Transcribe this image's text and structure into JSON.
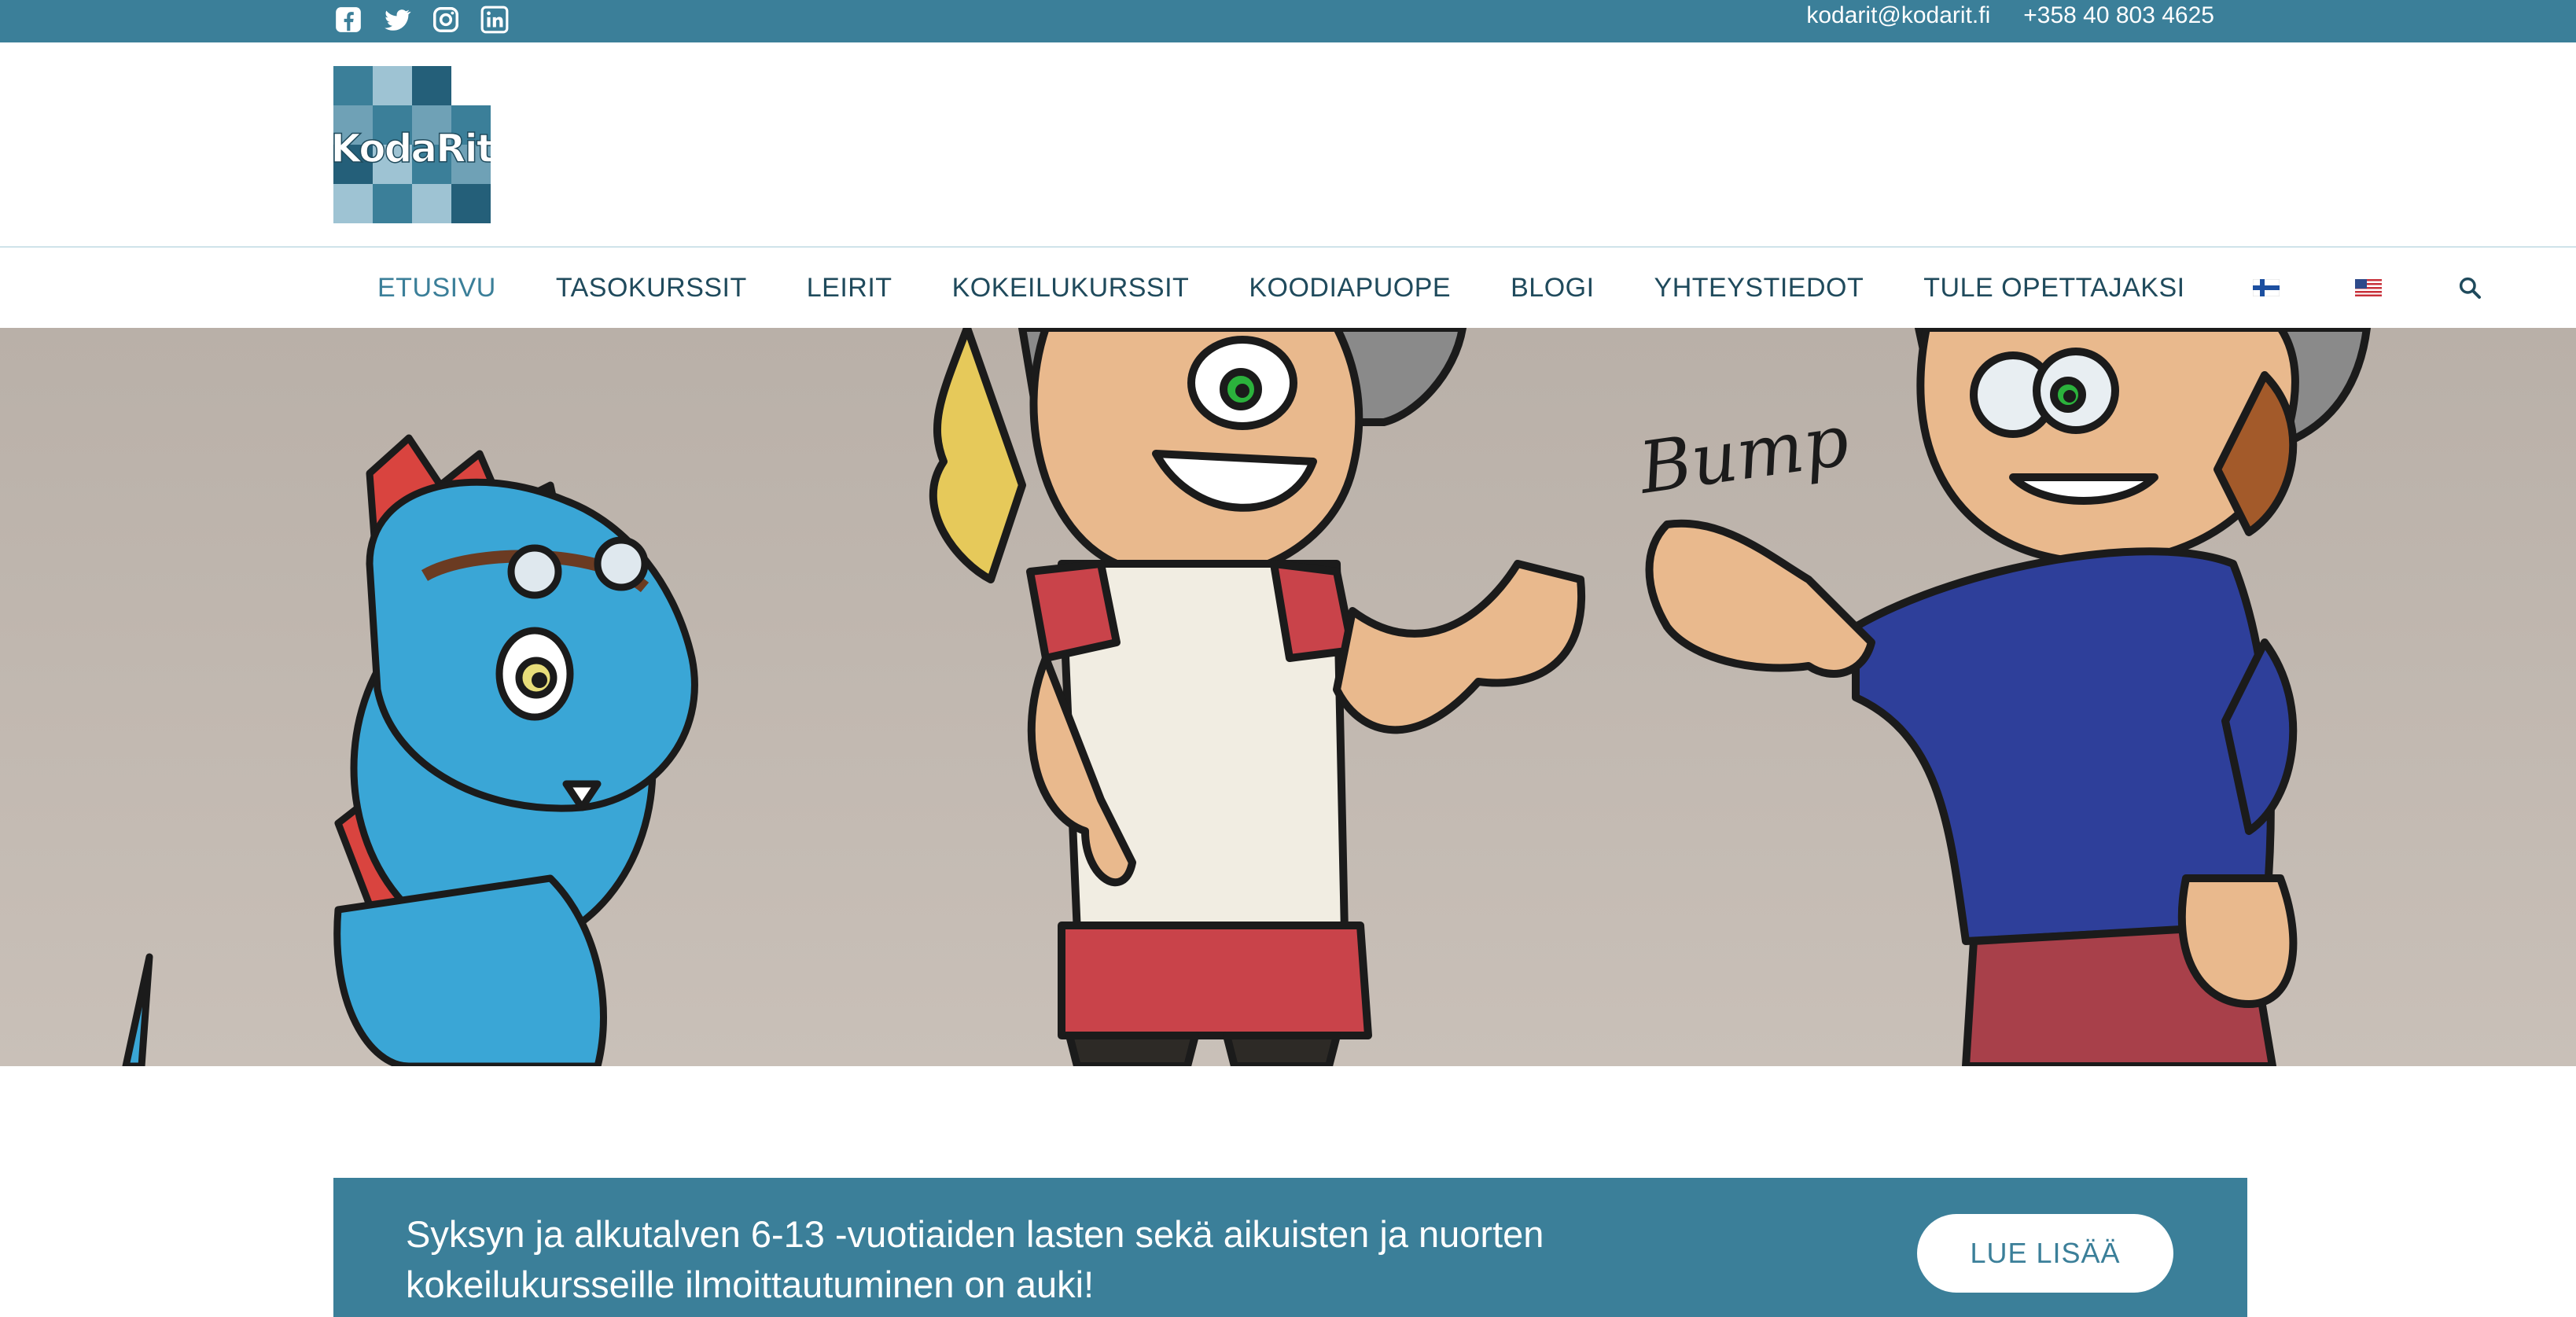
{
  "topbar": {
    "social": [
      {
        "icon": "facebook-icon"
      },
      {
        "icon": "twitter-icon"
      },
      {
        "icon": "instagram-icon"
      },
      {
        "icon": "linkedin-icon"
      }
    ],
    "email": "kodarit@kodarit.fi",
    "phone": "+358 40 803 4625"
  },
  "logo": {
    "text": "KodaRit"
  },
  "nav": {
    "items": [
      {
        "label": "ETUSIVU",
        "active": true
      },
      {
        "label": "TASOKURSSIT"
      },
      {
        "label": "LEIRIT"
      },
      {
        "label": "KOKEILUKURSSIT"
      },
      {
        "label": "KOODIAPUOPE"
      },
      {
        "label": "BLOGI"
      },
      {
        "label": "YHTEYSTIEDOT"
      },
      {
        "label": "TULE OPETTAJAKSI"
      }
    ],
    "language_icons": [
      "finland-flag-icon",
      "usa-flag-icon"
    ],
    "search_icon": "search-icon"
  },
  "hero": {
    "illustration_text": "Bump"
  },
  "banner": {
    "line1": "Syksyn ja alkutalven 6-13 -vuotiaiden lasten sekä aikuisten ja nuorten",
    "line2": "kokeilukursseille ilmoittautuminen on auki!",
    "button_label": "LUE LISÄÄ"
  },
  "colors": {
    "primary": "#3b7f99",
    "nav_text": "#1f4a5c",
    "hero_background": "#c2b8b0"
  }
}
